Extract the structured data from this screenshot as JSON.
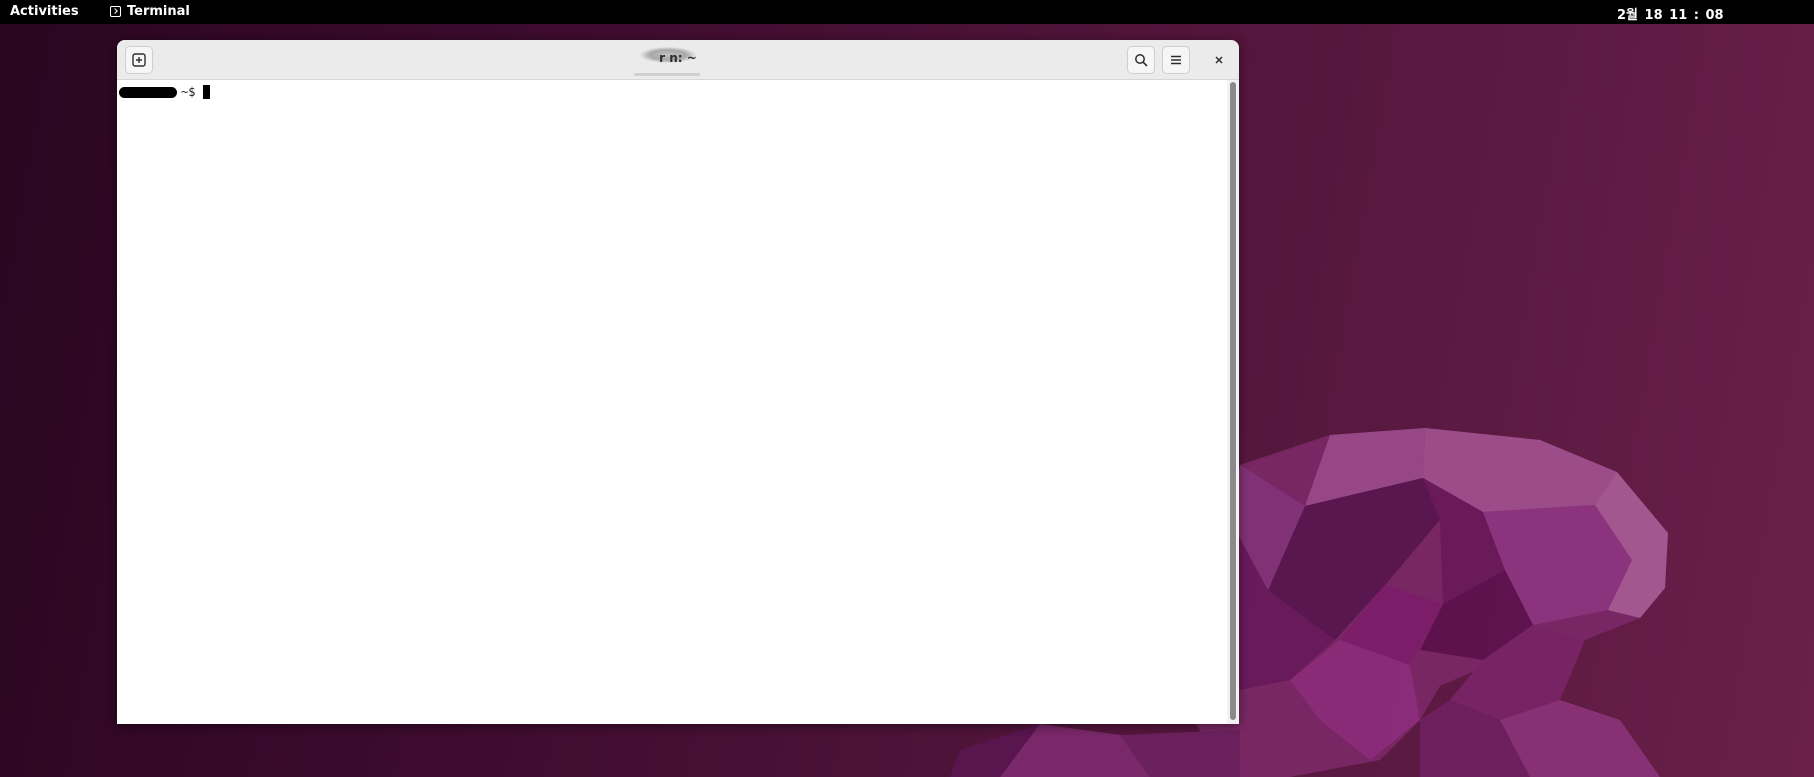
{
  "topbar": {
    "activities_label": "Activities",
    "app_name": "Terminal",
    "clock": "2월 18  11 : 08"
  },
  "window": {
    "title": "r         n: ~",
    "new_tab_icon": "new-tab-icon",
    "search_icon": "search-icon",
    "menu_icon": "hamburger-menu-icon",
    "close_icon": "close-icon"
  },
  "terminal": {
    "prompt_suffix": "~$",
    "input_value": ""
  },
  "colors": {
    "topbar_bg": "#000000",
    "headerbar_bg": "#ebebeb",
    "terminal_bg": "#ffffff",
    "wallpaper_dark": "#2a0620",
    "wallpaper_accent": "#8e2d78"
  }
}
